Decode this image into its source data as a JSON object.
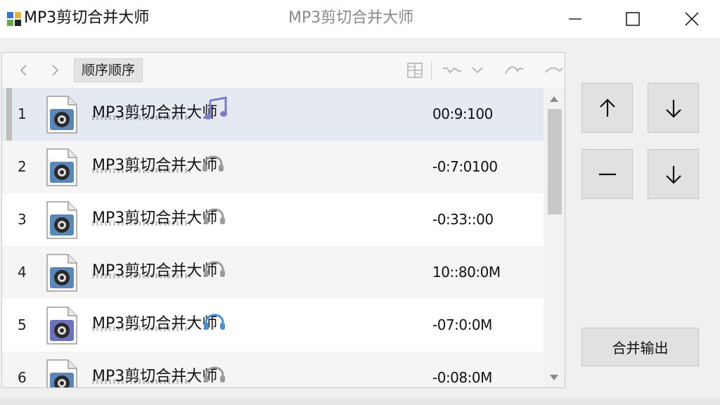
{
  "window": {
    "title": "MP3剪切合并大师",
    "center_title": "MP3剪切合并大师"
  },
  "toolbar": {
    "sort_label": "顺序顺序"
  },
  "rows": [
    {
      "index": "1",
      "name": "MP3剪切合并大师",
      "duration": "00:9:100",
      "badge": "music-note-icon"
    },
    {
      "index": "2",
      "name": "MP3剪切合并大师",
      "duration": "-0:7:0100",
      "badge": "headphones-icon"
    },
    {
      "index": "3",
      "name": "MP3剪切合并大师",
      "duration": "-0:33::00",
      "badge": "headphones-icon"
    },
    {
      "index": "4",
      "name": "MP3剪切合并大师",
      "duration": "10::80:0M",
      "badge": "headphones-icon"
    },
    {
      "index": "5",
      "name": "MP3剪切合并大师",
      "duration": "-07:0:0M",
      "badge": "headphones-icon"
    },
    {
      "index": "6",
      "name": "MP3剪切合并大师",
      "duration": "-0:08:0M",
      "badge": "headphones-icon"
    }
  ],
  "side_panel": {
    "merge_label": "合并输出"
  },
  "colors": {
    "selected_row": "#e5e9f1",
    "button_face": "#e1e1e1",
    "file_icon_blue": "#5b86b8",
    "accent_purple": "#7a7fc4"
  }
}
